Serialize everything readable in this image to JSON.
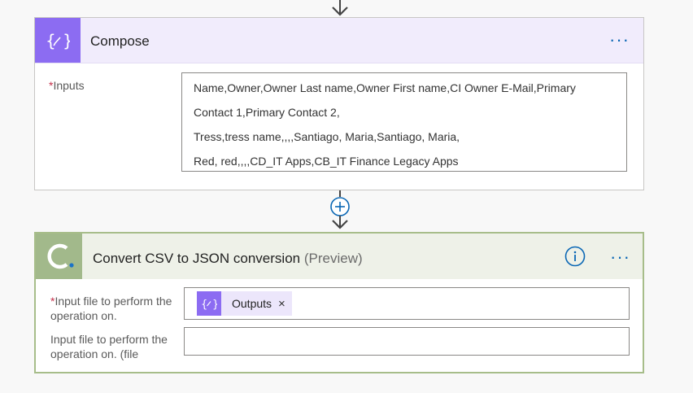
{
  "compose": {
    "title": "Compose",
    "more_label": "···",
    "inputs_required_mark": "*",
    "inputs_label": "Inputs",
    "inputs_lines": [
      "Name,Owner,Owner Last name,Owner First name,CI Owner E-Mail,Primary",
      "Contact 1,Primary Contact 2,",
      "Tress,tress name,,,,Santiago, Maria,Santiago, Maria,",
      "Red, red,,,,CD_IT  Apps,CB_IT Finance Legacy Apps"
    ],
    "icon": "curly-braces-pencil-icon",
    "accent_color": "#8c6cf2"
  },
  "connector": {
    "add_step_icon": "plus-circle-icon",
    "arrow_icon": "arrow-down-icon"
  },
  "convert": {
    "title": "Convert CSV to JSON conversion",
    "preview_tag": "(Preview)",
    "more_label": "···",
    "info_icon": "info-circle-icon",
    "field1_required_mark": "*",
    "field1_label": "Input file to perform the operation on.",
    "field1_token_label": "Outputs",
    "field1_token_remove": "×",
    "field2_label": "Input file to perform the operation on. (file",
    "accent_color": "#a2b98b"
  }
}
